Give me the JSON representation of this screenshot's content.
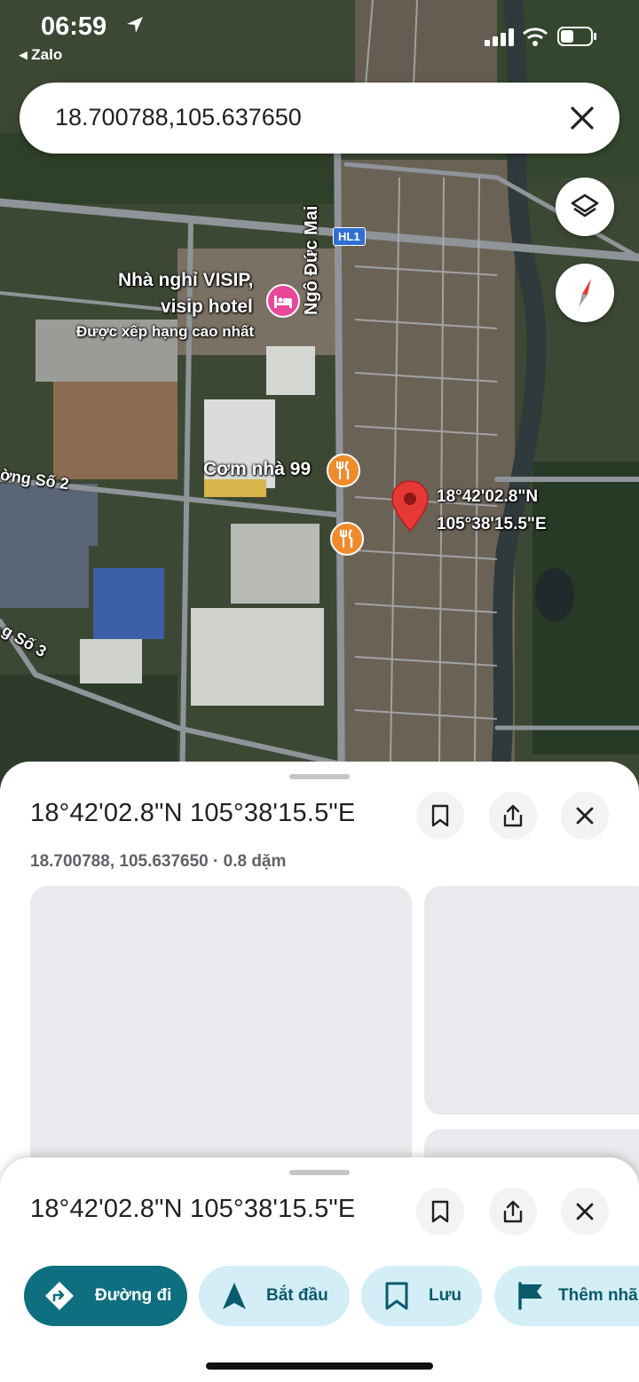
{
  "status_bar": {
    "time": "06:59",
    "back_app": "◂ Zalo"
  },
  "search": {
    "value": "18.700788,105.637650"
  },
  "map": {
    "labels": {
      "hotel_line1": "Nhà nghỉ VISIP,",
      "hotel_line2": "visip hotel",
      "hotel_rating": "Được xếp hạng cao nhất",
      "street_ngo_duc_mai": "Ngô Đức Mai",
      "restaurant": "Cơm nhà 99",
      "road_so2": "ờng Số 2",
      "road_so3": "g Số 3",
      "route_shield": "HL1",
      "pin_lat": "18°42'02.8\"N",
      "pin_lng": "105°38'15.5\"E"
    }
  },
  "sheet_expanded": {
    "title": "18°42'02.8\"N 105°38'15.5\"E",
    "subtitle": "18.700788, 105.637650 · 0.8 dặm"
  },
  "sheet_collapsed": {
    "title": "18°42'02.8\"N 105°38'15.5\"E",
    "actions": [
      {
        "label": "Đường đi",
        "icon": "directions-icon"
      },
      {
        "label": "Bắt đầu",
        "icon": "navigation-arrow-icon"
      },
      {
        "label": "Lưu",
        "icon": "bookmark-icon"
      },
      {
        "label": "Thêm nhã",
        "icon": "flag-icon"
      }
    ]
  },
  "colors": {
    "accent": "#0e6f80",
    "chip_bg": "#d3eef7",
    "pin": "#e53935",
    "hotel_poi": "#e8479b",
    "food_poi": "#f08b2c"
  }
}
